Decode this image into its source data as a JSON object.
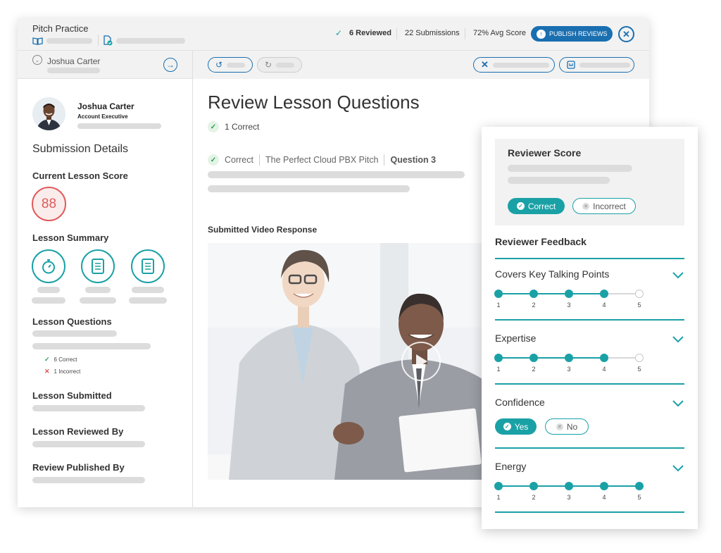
{
  "topbar": {
    "app_title": "Pitch Practice",
    "stats": {
      "reviewed": "6 Reviewed",
      "submissions": "22 Submissions",
      "avg_score": "72% Avg Score"
    },
    "publish_label": "PUBLISH REVIEWS"
  },
  "sidebar": {
    "header_name": "Joshua Carter",
    "profile": {
      "name": "Joshua Carter",
      "role": "Account Executive"
    },
    "submission_details": "Submission Details",
    "current_score_label": "Current Lesson Score",
    "score": "88",
    "lesson_summary_label": "Lesson Summary",
    "lesson_questions_label": "Lesson Questions",
    "questions": {
      "correct": "6 Correct",
      "incorrect": "1 Incorrect"
    },
    "lesson_submitted_label": "Lesson Submitted",
    "lesson_reviewed_by_label": "Lesson Reviewed By",
    "review_published_by_label": "Review Published By"
  },
  "main": {
    "title": "Review Lesson Questions",
    "correct_summary": "1 Correct",
    "breadcrumb": {
      "status": "Correct",
      "lesson": "The Perfect Cloud PBX Pitch",
      "question": "Question 3"
    },
    "video_label": "Submitted Video Response"
  },
  "panel": {
    "reviewer_score_title": "Reviewer Score",
    "correct_label": "Correct",
    "incorrect_label": "Incorrect",
    "feedback_title": "Reviewer Feedback",
    "criteria": [
      {
        "name": "Covers Key Talking Points",
        "value": 4,
        "max": 5
      },
      {
        "name": "Expertise",
        "value": 4,
        "max": 5
      },
      {
        "name": "Confidence",
        "yes": "Yes",
        "no": "No",
        "selected": "Yes"
      },
      {
        "name": "Energy",
        "value": 5,
        "max": 5
      }
    ],
    "scale_labels": [
      "1",
      "2",
      "3",
      "4",
      "5"
    ]
  },
  "colors": {
    "teal": "#1aa1a6",
    "blue": "#1a6fb0",
    "score_red": "#e05a5a",
    "green": "#2e9d52"
  }
}
